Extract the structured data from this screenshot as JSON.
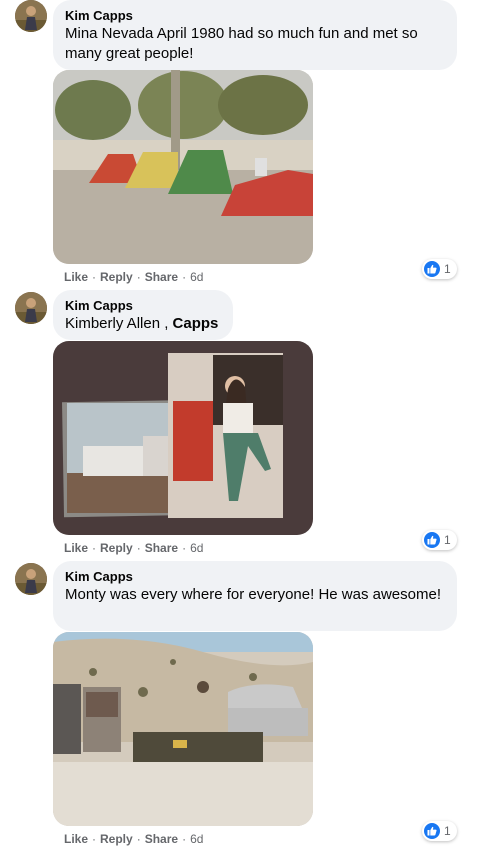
{
  "comments": [
    {
      "author": "Kim Capps",
      "text": "Mina Nevada April 1980 had so much fun and met so many great people!",
      "text_tag": "",
      "actions": {
        "like": "Like",
        "reply": "Reply",
        "share": "Share",
        "time": "6d"
      },
      "reaction_count": "1",
      "photo_subject": "tents-campsite"
    },
    {
      "author": "Kim Capps",
      "text": "Kimberly Allen , ",
      "text_tag": "Capps",
      "actions": {
        "like": "Like",
        "reply": "Reply",
        "share": "Share",
        "time": "6d"
      },
      "reaction_count": "1",
      "photo_subject": "woman-trailer-photo"
    },
    {
      "author": "Kim Capps",
      "text": "Monty was every where for everyone! He was awesome!",
      "text_tag": "",
      "actions": {
        "like": "Like",
        "reply": "Reply",
        "share": "Share",
        "time": "6d"
      },
      "reaction_count": "1",
      "photo_subject": "airstream-camp"
    }
  ],
  "icons": {
    "reaction": "thumbs-up-icon"
  },
  "colors": {
    "bubble": "#f0f2f5",
    "like_blue": "#1877f2",
    "meta_gray": "#65676b"
  }
}
